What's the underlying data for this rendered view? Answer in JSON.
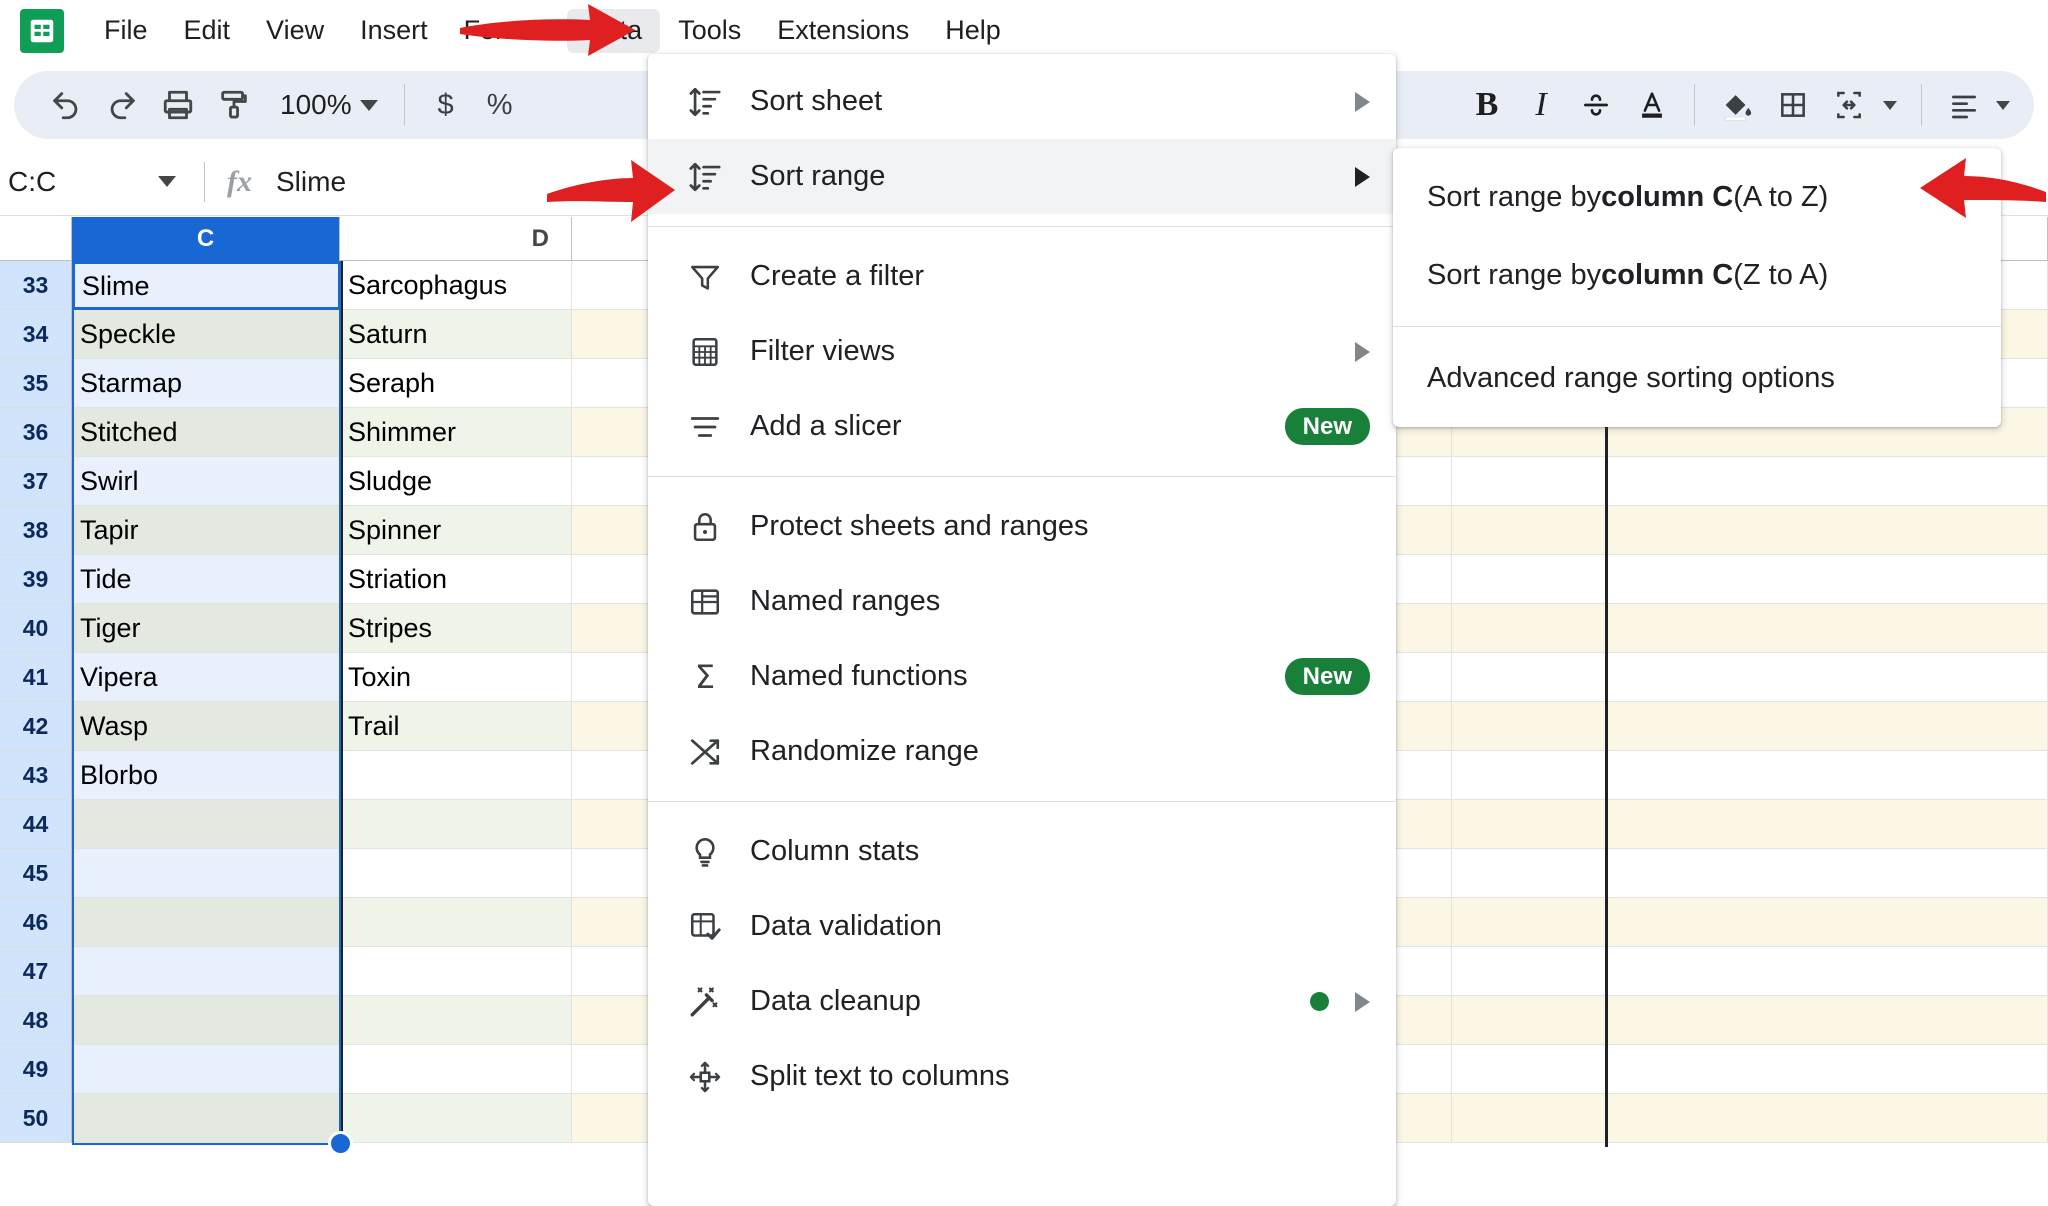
{
  "app": {
    "name": "Google Sheets",
    "logo_icon": "sheets-logo-icon"
  },
  "menubar": {
    "items": [
      {
        "label": "File",
        "active": false
      },
      {
        "label": "Edit",
        "active": false
      },
      {
        "label": "View",
        "active": false
      },
      {
        "label": "Insert",
        "active": false
      },
      {
        "label": "Format",
        "active": false
      },
      {
        "label": "Data",
        "active": true
      },
      {
        "label": "Tools",
        "active": false
      },
      {
        "label": "Extensions",
        "active": false
      },
      {
        "label": "Help",
        "active": false
      }
    ]
  },
  "toolbar": {
    "undo_icon": "undo-icon",
    "redo_icon": "redo-icon",
    "print_icon": "print-icon",
    "paint_format_icon": "paint-format-icon",
    "zoom_value": "100%",
    "currency_label": "$",
    "percent_label": "%",
    "bold_label": "B",
    "italic_label": "I",
    "strikethrough_icon": "strikethrough-icon",
    "text_color_label": "A",
    "fill_color_icon": "fill-color-icon",
    "borders_icon": "borders-icon",
    "merge_cells_icon": "merge-cells-icon",
    "align_icon": "horizontal-align-icon"
  },
  "formula_bar": {
    "name_box_value": "C:C",
    "fx_label": "fx",
    "value": "Slime"
  },
  "grid": {
    "columns": [
      {
        "label": "C",
        "selected": true
      },
      {
        "label": "D",
        "selected": false
      },
      {
        "label": "",
        "selected": false
      },
      {
        "label": "",
        "selected": false
      },
      {
        "label": "",
        "selected": false
      }
    ],
    "rows": [
      {
        "num": "33",
        "c": "Slime",
        "d": "Sarcophagus"
      },
      {
        "num": "34",
        "c": "Speckle",
        "d": "Saturn"
      },
      {
        "num": "35",
        "c": "Starmap",
        "d": "Seraph"
      },
      {
        "num": "36",
        "c": "Stitched",
        "d": "Shimmer"
      },
      {
        "num": "37",
        "c": "Swirl",
        "d": "Sludge"
      },
      {
        "num": "38",
        "c": "Tapir",
        "d": "Spinner"
      },
      {
        "num": "39",
        "c": "Tide",
        "d": "Striation"
      },
      {
        "num": "40",
        "c": "Tiger",
        "d": "Stripes"
      },
      {
        "num": "41",
        "c": "Vipera",
        "d": "Toxin"
      },
      {
        "num": "42",
        "c": "Wasp",
        "d": "Trail"
      },
      {
        "num": "43",
        "c": "Blorbo",
        "d": ""
      },
      {
        "num": "44",
        "c": "",
        "d": ""
      },
      {
        "num": "45",
        "c": "",
        "d": ""
      },
      {
        "num": "46",
        "c": "",
        "d": ""
      },
      {
        "num": "47",
        "c": "",
        "d": ""
      },
      {
        "num": "48",
        "c": "",
        "d": ""
      },
      {
        "num": "49",
        "c": "",
        "d": ""
      },
      {
        "num": "50",
        "c": "",
        "d": ""
      }
    ],
    "active_cell_value": "Slime",
    "selection_handle_icon": "selection-handle-icon"
  },
  "data_menu": {
    "items": [
      {
        "id": "sort-sheet",
        "label": "Sort sheet",
        "icon": "sort-icon",
        "arrow": true,
        "badge": "",
        "dot": false,
        "highlighted": false
      },
      {
        "id": "sort-range",
        "label": "Sort range",
        "icon": "sort-icon",
        "arrow": true,
        "badge": "",
        "dot": false,
        "highlighted": true
      },
      {
        "id": "divider-1",
        "label": "",
        "icon": "",
        "arrow": false,
        "badge": "",
        "dot": false,
        "highlighted": false
      },
      {
        "id": "create-a-filter",
        "label": "Create a filter",
        "icon": "filter-icon",
        "arrow": false,
        "badge": "",
        "dot": false,
        "highlighted": false
      },
      {
        "id": "filter-views",
        "label": "Filter views",
        "icon": "filter-views-icon",
        "arrow": true,
        "badge": "",
        "dot": false,
        "highlighted": false
      },
      {
        "id": "add-a-slicer",
        "label": "Add a slicer",
        "icon": "slicer-icon",
        "arrow": false,
        "badge": "New",
        "dot": false,
        "highlighted": false
      },
      {
        "id": "divider-2",
        "label": "",
        "icon": "",
        "arrow": false,
        "badge": "",
        "dot": false,
        "highlighted": false
      },
      {
        "id": "protect-sheets",
        "label": "Protect sheets and ranges",
        "icon": "lock-icon",
        "arrow": false,
        "badge": "",
        "dot": false,
        "highlighted": false
      },
      {
        "id": "named-ranges",
        "label": "Named ranges",
        "icon": "named-ranges-icon",
        "arrow": false,
        "badge": "",
        "dot": false,
        "highlighted": false
      },
      {
        "id": "named-functions",
        "label": "Named functions",
        "icon": "sigma-icon",
        "arrow": false,
        "badge": "New",
        "dot": false,
        "highlighted": false
      },
      {
        "id": "randomize-range",
        "label": "Randomize range",
        "icon": "shuffle-icon",
        "arrow": false,
        "badge": "",
        "dot": false,
        "highlighted": false
      },
      {
        "id": "divider-3",
        "label": "",
        "icon": "",
        "arrow": false,
        "badge": "",
        "dot": false,
        "highlighted": false
      },
      {
        "id": "column-stats",
        "label": "Column stats",
        "icon": "lightbulb-icon",
        "arrow": false,
        "badge": "",
        "dot": false,
        "highlighted": false
      },
      {
        "id": "data-validation",
        "label": "Data validation",
        "icon": "data-validation-icon",
        "arrow": false,
        "badge": "",
        "dot": false,
        "highlighted": false
      },
      {
        "id": "data-cleanup",
        "label": "Data cleanup",
        "icon": "magic-wand-icon",
        "arrow": true,
        "badge": "",
        "dot": true,
        "highlighted": false
      },
      {
        "id": "split-text",
        "label": "Split text to columns",
        "icon": "split-text-icon",
        "arrow": false,
        "badge": "",
        "dot": false,
        "highlighted": false
      }
    ]
  },
  "sort_range_submenu": {
    "items": [
      {
        "id": "sort-az",
        "pre": "Sort range by ",
        "bold": "column C",
        "post": " (A to Z)"
      },
      {
        "id": "sort-za",
        "pre": "Sort range by ",
        "bold": "column C",
        "post": " (Z to A)"
      },
      {
        "id": "divider",
        "pre": "",
        "bold": "",
        "post": ""
      },
      {
        "id": "advanced",
        "pre": "Advanced range sorting options",
        "bold": "",
        "post": ""
      }
    ]
  },
  "annotations": {
    "arrow_color": "#e02020",
    "arrows": [
      {
        "id": "arrow-to-data-menu",
        "name": "red-arrow-pointing-to-data-menu"
      },
      {
        "id": "arrow-to-sort-range",
        "name": "red-arrow-pointing-to-sort-range"
      },
      {
        "id": "arrow-to-sort-a-to-z",
        "name": "red-arrow-pointing-to-sort-a-to-z"
      }
    ]
  },
  "colors": {
    "accent": "#1967d2",
    "brand_green": "#0f9d58",
    "badge_green": "#188038",
    "toolbar_bg": "#e9eef6",
    "row_band_blue": "#e8f0fe",
    "row_band_gray": "#e3e8e0",
    "row_band_green": "#eaf2e3",
    "row_band_cream": "#fcf6e3"
  }
}
